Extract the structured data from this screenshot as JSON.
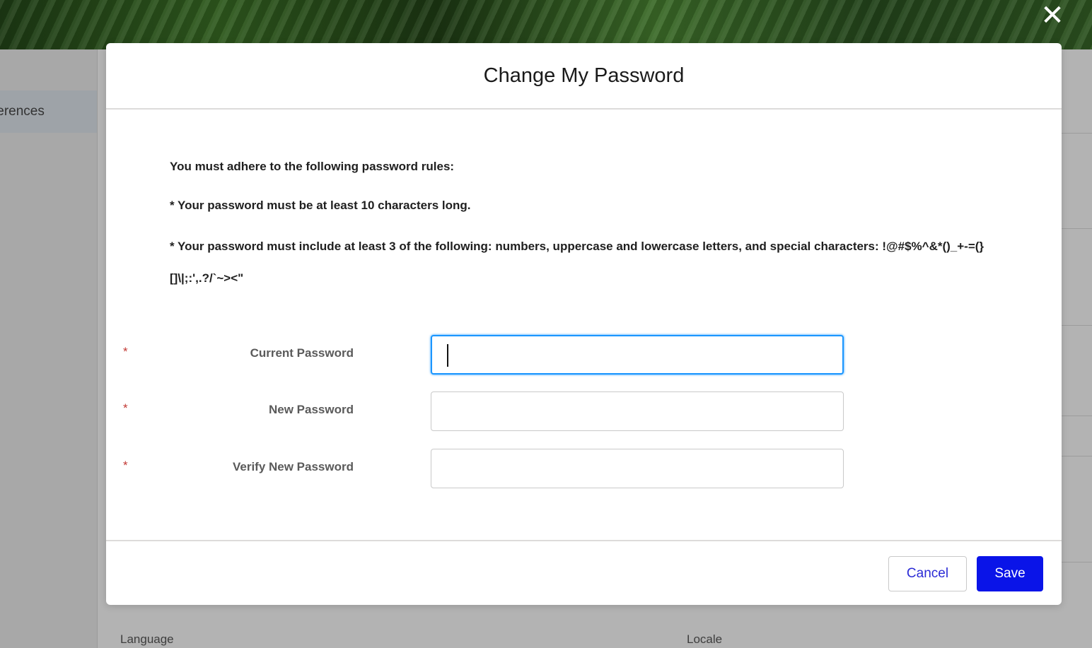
{
  "background": {
    "sidebar_item": "ferences",
    "language_label": "Language",
    "locale_label": "Locale",
    "close_glyph": "✕"
  },
  "modal": {
    "title": "Change My Password",
    "rules_heading": "You must adhere to the following password rules:",
    "rule_length": "* Your password must be at least 10 characters long.",
    "rule_complexity": "* Your password must include at least 3 of the following: numbers, uppercase and lowercase letters, and special characters: !@#$%^&*()_+-=(}[]\\|;:',.?/`~><\"",
    "required_marker": "*",
    "fields": [
      {
        "label": "Current Password",
        "value": "",
        "focused": true
      },
      {
        "label": "New Password",
        "value": "",
        "focused": false
      },
      {
        "label": "Verify New Password",
        "value": "",
        "focused": false
      }
    ],
    "cancel_label": "Cancel",
    "save_label": "Save"
  },
  "colors": {
    "save_button": "#0a14e8",
    "focus_border": "#1b96ff",
    "required": "#c23934"
  }
}
